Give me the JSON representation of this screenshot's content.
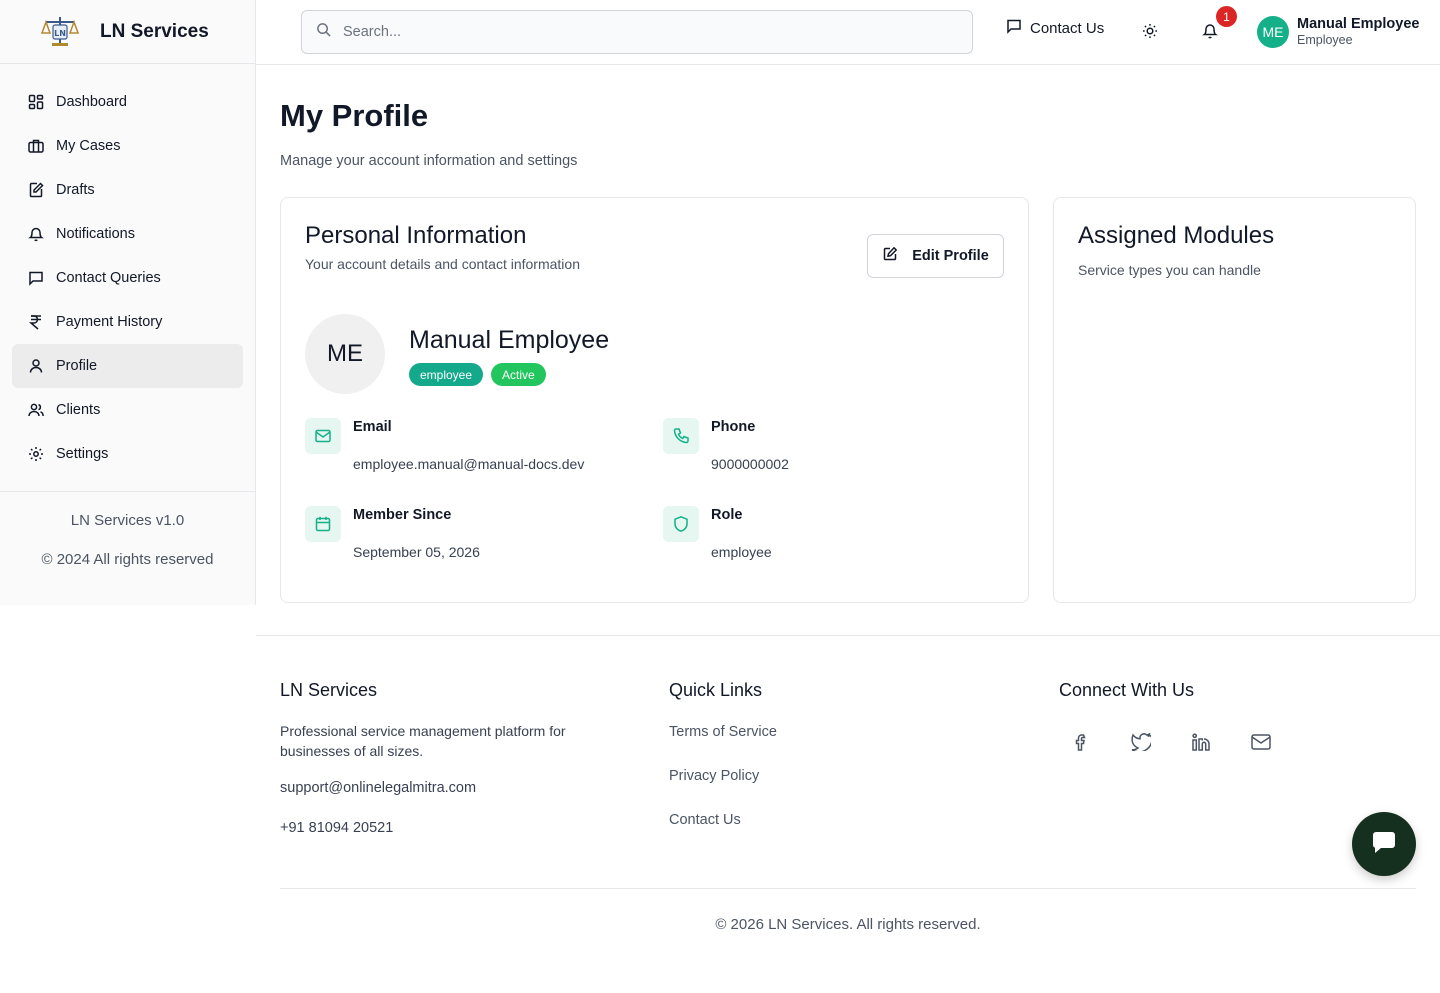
{
  "brand": {
    "name": "LN Services",
    "logo_icon": "scales-of-justice-logo"
  },
  "sidebar": {
    "items": [
      {
        "label": "Dashboard",
        "icon": "dashboard-icon"
      },
      {
        "label": "My Cases",
        "icon": "briefcase-icon"
      },
      {
        "label": "Drafts",
        "icon": "edit-document-icon"
      },
      {
        "label": "Notifications",
        "icon": "bell-icon"
      },
      {
        "label": "Contact Queries",
        "icon": "message-icon"
      },
      {
        "label": "Payment History",
        "icon": "rupee-icon"
      },
      {
        "label": "Profile",
        "icon": "user-icon",
        "active": true
      },
      {
        "label": "Clients",
        "icon": "users-icon"
      },
      {
        "label": "Settings",
        "icon": "gear-icon"
      }
    ],
    "version": "LN Services v1.0",
    "copyright": "© 2024 All rights reserved"
  },
  "header": {
    "search_placeholder": "Search...",
    "contact_label": "Contact Us",
    "notification_count": "1",
    "user": {
      "initials": "ME",
      "name": "Manual Employee",
      "role": "Employee"
    }
  },
  "page": {
    "title": "My Profile",
    "subtitle": "Manage your account information and settings"
  },
  "personal": {
    "title": "Personal Information",
    "description": "Your account details and contact information",
    "edit_label": "Edit Profile",
    "initials": "ME",
    "name": "Manual Employee",
    "role_badge": "employee",
    "status_badge": "Active",
    "fields": {
      "email": {
        "label": "Email",
        "value": "employee.manual@manual-docs.dev"
      },
      "phone": {
        "label": "Phone",
        "value": "9000000002"
      },
      "member_since": {
        "label": "Member Since",
        "value": "September 05, 2026"
      },
      "role": {
        "label": "Role",
        "value": "employee"
      }
    }
  },
  "modules": {
    "title": "Assigned Modules",
    "description": "Service types you can handle"
  },
  "footer": {
    "about": {
      "title": "LN Services",
      "description": "Professional service management platform for businesses of all sizes.",
      "email": "support@onlinelegalmitra.com",
      "phone": "+91 81094 20521"
    },
    "quick_links": {
      "title": "Quick Links",
      "links": [
        "Terms of Service",
        "Privacy Policy",
        "Contact Us"
      ]
    },
    "connect": {
      "title": "Connect With Us",
      "icons": [
        "facebook-icon",
        "twitter-icon",
        "linkedin-icon",
        "mail-icon"
      ]
    },
    "copyright": "© 2026 LN Services. All rights reserved."
  },
  "colors": {
    "accent": "#14b08a",
    "role_badge": "#13a98a",
    "status_badge": "#22c55e",
    "notification_badge": "#dc2626",
    "chat_button": "#163020"
  }
}
